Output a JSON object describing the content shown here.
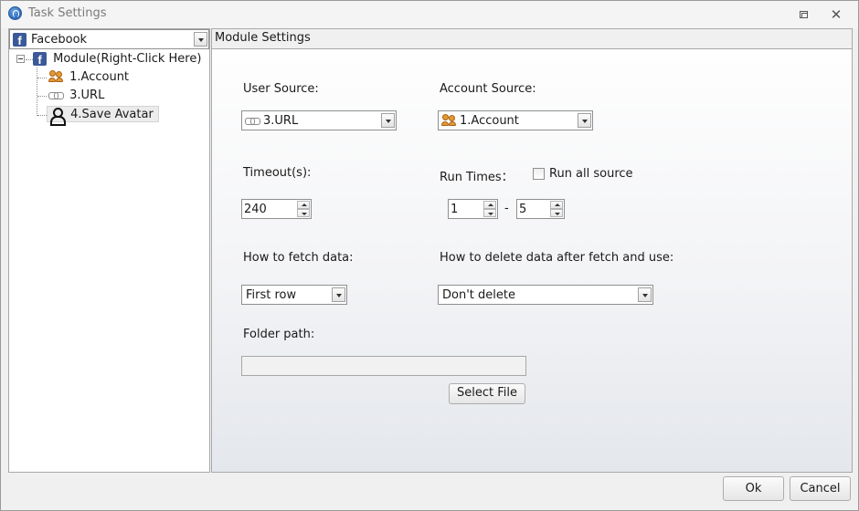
{
  "window": {
    "title": "Task Settings"
  },
  "left": {
    "site_select": "Facebook",
    "tree": {
      "root": "Module(Right-Click Here)",
      "children": [
        "1.Account",
        "3.URL",
        "4.Save Avatar"
      ],
      "selected": "4.Save Avatar"
    }
  },
  "main": {
    "header": "Module Settings",
    "user_source_label": "User Source:",
    "user_source_value": "3.URL",
    "account_source_label": "Account Source:",
    "account_source_value": "1.Account",
    "timeout_label": "Timeout(s):",
    "timeout_value": "240",
    "run_times_label": "Run Times：",
    "run_all_label": "Run all source",
    "run_all_checked": false,
    "run_times_from": "1",
    "run_times_dash": "-",
    "run_times_to": "5",
    "fetch_label": "How to fetch data:",
    "fetch_value": "First row",
    "delete_label": "How to delete data after fetch and use:",
    "delete_value": "Don't delete",
    "folder_label": "Folder path:",
    "folder_value": "",
    "select_file": "Select File"
  },
  "footer": {
    "ok": "Ok",
    "cancel": "Cancel"
  },
  "icons": [
    "app-icon",
    "restore-icon",
    "close-icon",
    "facebook-icon",
    "link-icon",
    "users-icon",
    "user-icon",
    "chevron-down-icon"
  ]
}
